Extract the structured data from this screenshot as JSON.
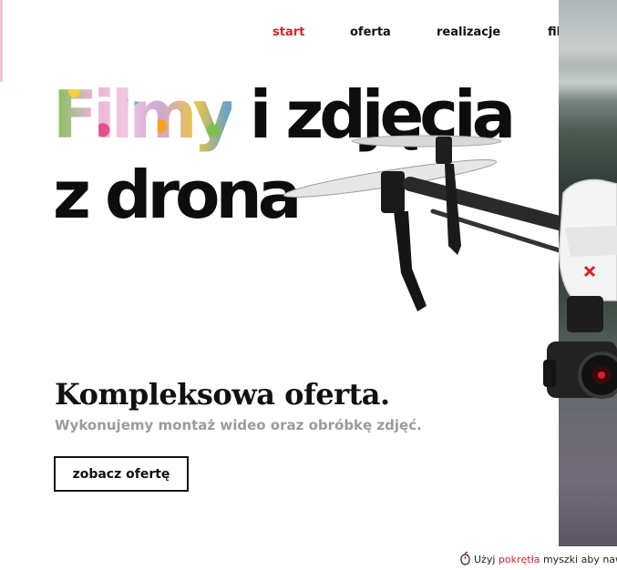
{
  "nav": {
    "items": [
      {
        "label": "start",
        "active": true
      },
      {
        "label": "oferta",
        "active": false
      },
      {
        "label": "realizacje",
        "active": false
      },
      {
        "label": "filmowanie",
        "active": false
      }
    ]
  },
  "hero": {
    "highlight_word": "Filmy",
    "line1_rest": " i zdjęcia",
    "line2": "z drona",
    "tagline": "Kompleksowa oferta.",
    "subline": "Wykonujemy montaż wideo oraz obróbkę zdjęć.",
    "cta_label": "zobacz ofertę"
  },
  "scroll_hint": {
    "prefix": "Użyj ",
    "highlight": "pokrętła",
    "suffix": " myszki aby nawigować"
  },
  "colors": {
    "accent": "#d9202c",
    "text": "#111111",
    "muted": "#9b9b9b"
  }
}
